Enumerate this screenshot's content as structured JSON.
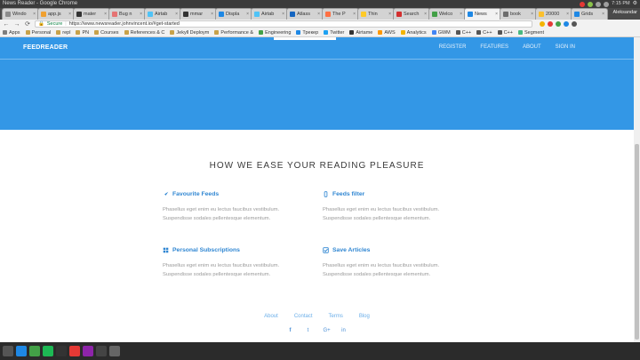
{
  "window": {
    "title": "News Reader - Google Chrome",
    "user": "Aleksandar",
    "time": "7:15 PM"
  },
  "tabs": [
    {
      "label": "Windo",
      "color": "#8c8c8c"
    },
    {
      "label": "app.js",
      "color": "#f0a030"
    },
    {
      "label": "mater",
      "color": "#333333"
    },
    {
      "label": "Bug n",
      "color": "#e57373"
    },
    {
      "label": "Airtab",
      "color": "#4fc3f7"
    },
    {
      "label": "mmar",
      "color": "#333333"
    },
    {
      "label": "Displa",
      "color": "#1e88e5"
    },
    {
      "label": "Airtab",
      "color": "#4fc3f7"
    },
    {
      "label": "Atlass",
      "color": "#1565c0"
    },
    {
      "label": "The P",
      "color": "#ff7043"
    },
    {
      "label": "Thin",
      "color": "#ffca28"
    },
    {
      "label": "Search",
      "color": "#d32f2f"
    },
    {
      "label": "Welco",
      "color": "#43a047"
    },
    {
      "label": "News",
      "color": "#1e88e5",
      "active": true
    },
    {
      "label": "book",
      "color": "#6d6d6d"
    },
    {
      "label": "20000",
      "color": "#fbc02d"
    },
    {
      "label": "Grids",
      "color": "#1e88e5"
    }
  ],
  "address": {
    "secure_label": "Secure",
    "url": "https://www.newsreader.johnvincent.io/#get-started"
  },
  "bookmarks": [
    {
      "label": "Apps",
      "color": "#7e7e7e"
    },
    {
      "label": "Personal",
      "color": "#c8a24a"
    },
    {
      "label": "repl",
      "color": "#c8a24a"
    },
    {
      "label": "PN",
      "color": "#c8a24a"
    },
    {
      "label": "Courses",
      "color": "#c8a24a"
    },
    {
      "label": "References & C",
      "color": "#c8a24a"
    },
    {
      "label": "Jekyll Deploym",
      "color": "#c8a24a"
    },
    {
      "label": "Performance &",
      "color": "#c8a24a"
    },
    {
      "label": "Engineering",
      "color": "#43a047"
    },
    {
      "label": "Трекер",
      "color": "#1e88e5"
    },
    {
      "label": "Twitter",
      "color": "#1da1f2"
    },
    {
      "label": "Airtame",
      "color": "#333333"
    },
    {
      "label": "AWS",
      "color": "#ff9800"
    },
    {
      "label": "Analytics",
      "color": "#f4b400"
    },
    {
      "label": "GWM",
      "color": "#4285f4"
    },
    {
      "label": "C++",
      "color": "#555555"
    },
    {
      "label": "C++",
      "color": "#555555"
    },
    {
      "label": "C++",
      "color": "#555555"
    },
    {
      "label": "Segment",
      "color": "#49b881"
    }
  ],
  "site": {
    "brand": "FEEDREADER",
    "nav": [
      "REGISTER",
      "FEATURES",
      "ABOUT",
      "SIGN IN"
    ],
    "section_title": "HOW WE EASE YOUR READING PLEASURE",
    "features": [
      {
        "icon": "rocket-icon",
        "title": "Favourite Feeds",
        "line1": "Phasellus eget enim eu lectus faucibus vestibulum.",
        "line2": "Suspendisse sodales pellentesque elementum."
      },
      {
        "icon": "mobile-icon",
        "title": "Feeds filter",
        "line1": "Phasellus eget enim eu lectus faucibus vestibulum.",
        "line2": "Suspendisse sodales pellentesque elementum."
      },
      {
        "icon": "grid-icon",
        "title": "Personal Subscriptions",
        "line1": "Phasellus eget enim eu lectus faucibus vestibulum.",
        "line2": "Suspendisse sodales pellentesque elementum."
      },
      {
        "icon": "check-square-icon",
        "title": "Save Articles",
        "line1": "Phasellus eget enim eu lectus faucibus vestibulum.",
        "line2": "Suspendisse sodales pellentesque elementum."
      }
    ],
    "footer_links": [
      "About",
      "Contact",
      "Terms",
      "Blog"
    ],
    "social": [
      "f",
      "t",
      "G+",
      "in"
    ]
  },
  "colors": {
    "primary": "#3397e6",
    "accent": "#2f86d2"
  }
}
